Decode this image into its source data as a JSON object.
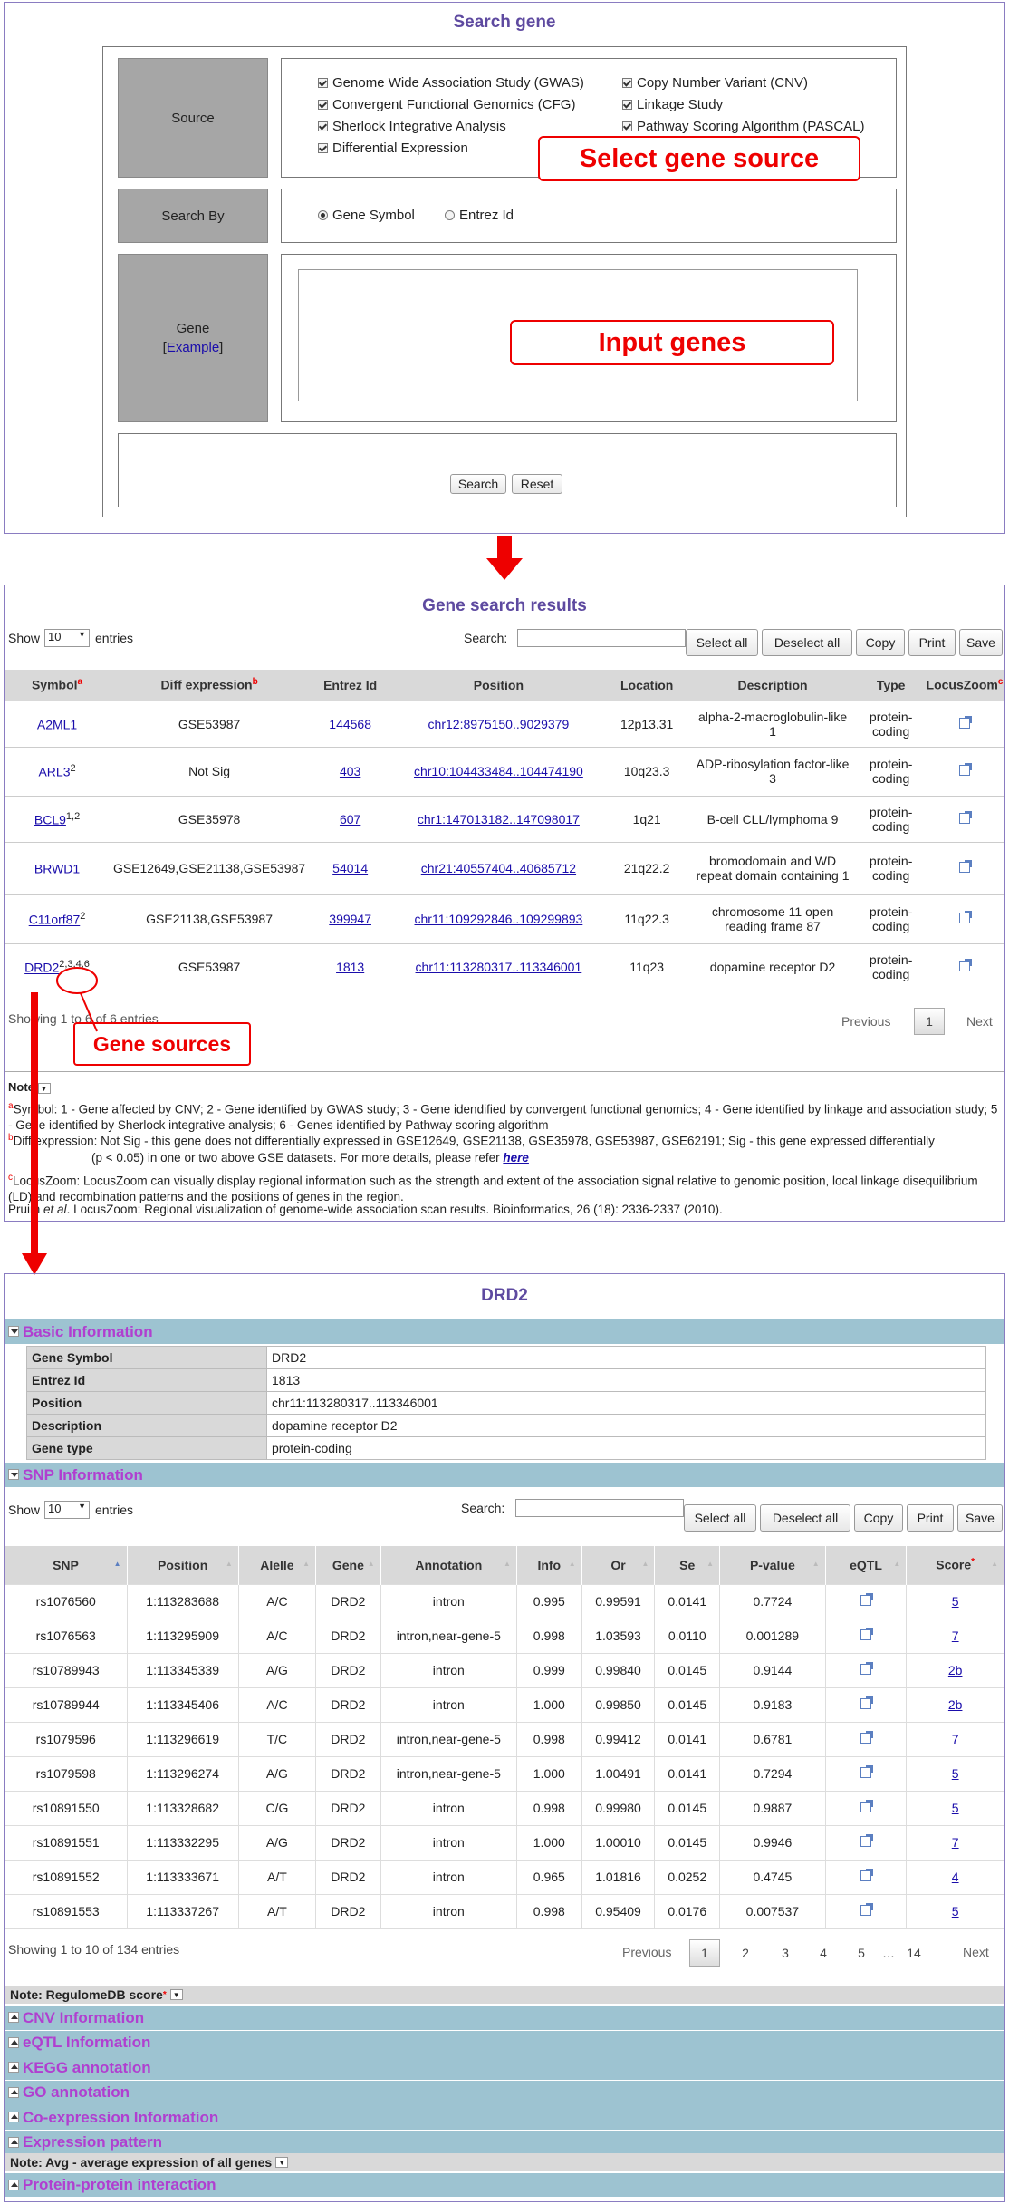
{
  "search": {
    "title": "Search gene",
    "source_label": "Source",
    "sources": [
      "Genome Wide Association Study (GWAS)",
      "Copy Number Variant (CNV)",
      "Convergent Functional Genomics (CFG)",
      "Linkage Study",
      "Sherlock Integrative Analysis",
      "Pathway Scoring Algorithm (PASCAL)",
      "Differential Expression"
    ],
    "select_callout": "Select gene source",
    "search_by_label": "Search By",
    "opt_symbol": "Gene Symbol",
    "opt_entrez": "Entrez Id",
    "gene_label": "Gene",
    "example_open": "[",
    "example": "Example",
    "example_close": "]",
    "input_callout": "Input genes",
    "search_btn": "Search",
    "reset_btn": "Reset"
  },
  "results": {
    "title": "Gene search results",
    "show": "Show",
    "entries_sel": "10",
    "entries": "entries",
    "search_label": "Search:",
    "buttons": [
      "Select all",
      "Deselect all",
      "Copy",
      "Print",
      "Save"
    ],
    "headers": [
      "Symbol",
      "Diff expression",
      "Entrez Id",
      "Position",
      "Location",
      "Description",
      "Type",
      "LocusZoom"
    ],
    "hdr_sup": [
      "a",
      "b",
      "c"
    ],
    "rows": [
      {
        "symbol": "A2ML1",
        "sup": "",
        "diff": "GSE53987",
        "entrez": "144568",
        "pos": "chr12:8975150..9029379",
        "loc": "12p13.31",
        "desc": "alpha-2-macroglobulin-like 1",
        "type": "protein-coding"
      },
      {
        "symbol": "ARL3",
        "sup": "2",
        "diff": "Not Sig",
        "entrez": "403",
        "pos": "chr10:104433484..104474190",
        "loc": "10q23.3",
        "desc": "ADP-ribosylation factor-like 3",
        "type": "protein-coding"
      },
      {
        "symbol": "BCL9",
        "sup": "1,2",
        "diff": "GSE35978",
        "entrez": "607",
        "pos": "chr1:147013182..147098017",
        "loc": "1q21",
        "desc": "B-cell CLL/lymphoma 9",
        "type": "protein-coding"
      },
      {
        "symbol": "BRWD1",
        "sup": "",
        "diff": "GSE12649,GSE21138,GSE53987",
        "entrez": "54014",
        "pos": "chr21:40557404..40685712",
        "loc": "21q22.2",
        "desc": "bromodomain and WD repeat domain containing 1",
        "type": "protein-coding"
      },
      {
        "symbol": "C11orf87",
        "sup": "2",
        "diff": "GSE21138,GSE53987",
        "entrez": "399947",
        "pos": "chr11:109292846..109299893",
        "loc": "11q22.3",
        "desc": "chromosome 11 open reading frame 87",
        "type": "protein-coding"
      },
      {
        "symbol": "DRD2",
        "sup": "2,3,4,6",
        "diff": "GSE53987",
        "entrez": "1813",
        "pos": "chr11:113280317..113346001",
        "loc": "11q23",
        "desc": "dopamine receptor D2",
        "type": "protein-coding"
      }
    ],
    "showing": "Showing 1 to 6 of 6 entries",
    "prev": "Previous",
    "page": "1",
    "next": "Next",
    "callout": "Gene sources",
    "note": "Note",
    "note_a": "Symbol: 1 - Gene affected by CNV; 2 - Gene identified by GWAS study; 3 - Gene idendified by convergent functional genomics; 4 - Gene identified by linkage and association study; 5 - Gene identified by Sherlock integrative analysis; 6 - Genes identified by Pathway scoring algorithm",
    "note_b": "Diff expression: Not Sig - this gene does not differentially expressed in GSE12649, GSE21138, GSE35978, GSE53987, GSE62191; Sig - this gene expressed differentially",
    "note_b2": "(p < 0.05) in one or two above GSE datasets. For more details, please refer",
    "note_b_link": "here",
    "note_c": "LocusZoom: LocusZoom can visually display regional information such as the strength and extent of the association signal relative to genomic position, local linkage disequilibrium (LD) and recombination patterns and the positions of genes in the region.",
    "note_ref1": "Pruim",
    "note_ref_em": "et al",
    "note_ref2": ". LocusZoom: Regional visualization of genome-wide association scan results. Bioinformatics, 26 (18): 2336-2337 (2010)."
  },
  "detail": {
    "title": "DRD2",
    "basic": "Basic Information",
    "info": [
      [
        "Gene Symbol",
        "DRD2"
      ],
      [
        "Entrez Id",
        "1813"
      ],
      [
        "Position",
        "chr11:113280317..113346001"
      ],
      [
        "Description",
        "dopamine receptor D2"
      ],
      [
        "Gene type",
        "protein-coding"
      ]
    ],
    "snp_bar": "SNP Information",
    "show": "Show",
    "entries_sel": "10",
    "entries": "entries",
    "search_label": "Search:",
    "buttons": [
      "Select all",
      "Deselect all",
      "Copy",
      "Print",
      "Save"
    ],
    "headers": [
      "SNP",
      "Position",
      "Alelle",
      "Gene",
      "Annotation",
      "Info",
      "Or",
      "Se",
      "P-value",
      "eQTL",
      "Score"
    ],
    "rows": [
      [
        "rs1076560",
        "1:113283688",
        "A/C",
        "DRD2",
        "intron",
        "0.995",
        "0.99591",
        "0.0141",
        "0.7724",
        "5"
      ],
      [
        "rs1076563",
        "1:113295909",
        "A/C",
        "DRD2",
        "intron,near-gene-5",
        "0.998",
        "1.03593",
        "0.0110",
        "0.001289",
        "7"
      ],
      [
        "rs10789943",
        "1:113345339",
        "A/G",
        "DRD2",
        "intron",
        "0.999",
        "0.99840",
        "0.0145",
        "0.9144",
        "2b"
      ],
      [
        "rs10789944",
        "1:113345406",
        "A/C",
        "DRD2",
        "intron",
        "1.000",
        "0.99850",
        "0.0145",
        "0.9183",
        "2b"
      ],
      [
        "rs1079596",
        "1:113296619",
        "T/C",
        "DRD2",
        "intron,near-gene-5",
        "0.998",
        "0.99412",
        "0.0141",
        "0.6781",
        "7"
      ],
      [
        "rs1079598",
        "1:113296274",
        "A/G",
        "DRD2",
        "intron,near-gene-5",
        "1.000",
        "1.00491",
        "0.0141",
        "0.7294",
        "5"
      ],
      [
        "rs10891550",
        "1:113328682",
        "C/G",
        "DRD2",
        "intron",
        "0.998",
        "0.99980",
        "0.0145",
        "0.9887",
        "5"
      ],
      [
        "rs10891551",
        "1:113332295",
        "A/G",
        "DRD2",
        "intron",
        "1.000",
        "1.00010",
        "0.0145",
        "0.9946",
        "7"
      ],
      [
        "rs10891552",
        "1:113333671",
        "A/T",
        "DRD2",
        "intron",
        "0.965",
        "1.01816",
        "0.0252",
        "0.4745",
        "4"
      ],
      [
        "rs10891553",
        "1:113337267",
        "A/T",
        "DRD2",
        "intron",
        "0.998",
        "0.95409",
        "0.0176",
        "0.007537",
        "5"
      ]
    ],
    "showing": "Showing 1 to 10 of 134 entries",
    "prev": "Previous",
    "pages": [
      "1",
      "2",
      "3",
      "4",
      "5",
      "…",
      "14"
    ],
    "next": "Next",
    "note_reg": "Note: RegulomeDB score",
    "sections": [
      "CNV Information",
      "eQTL Information",
      "KEGG annotation",
      "GO annotation",
      "Co-expression Information",
      "Expression pattern"
    ],
    "note_avg": "Note: Avg - average expression of all genes",
    "ppi": "Protein-protein interaction"
  },
  "colors": {
    "accent": "#5e4aa0",
    "callout": "#e00000",
    "bar": "#9dc3d1",
    "bar_text": "#b03fd0"
  }
}
